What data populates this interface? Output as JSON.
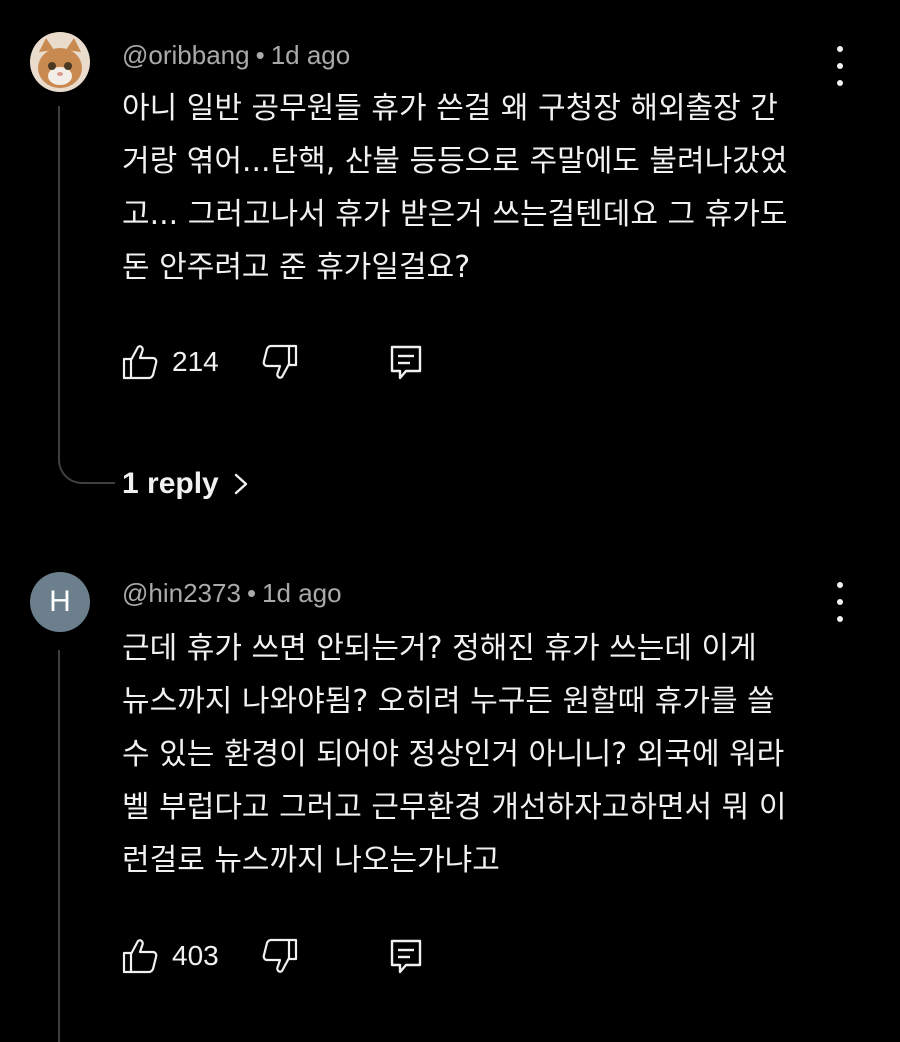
{
  "comments": [
    {
      "author": "@oribbang",
      "time": "1d ago",
      "avatar": "cat-photo",
      "lines": [
        "아니 일반 공무원들 휴가 쓴걸 왜 구청장 해외출장 간",
        "거랑 엮어...탄핵, 산불 등등으로 주말에도 불려나갔었",
        "고... 그러고나서 휴가 받은거 쓰는걸텐데요 그 휴가도",
        "돈 안주려고 준 휴가일걸요?"
      ],
      "likes": "214",
      "reply_label": "1 reply"
    },
    {
      "author": "@hin2373",
      "time": "1d ago",
      "avatar_letter": "H",
      "avatar_color": "#6b7f8d",
      "lines": [
        "근데 휴가 쓰면 안되는거? 정해진 휴가 쓰는데 이게",
        "뉴스까지 나와야됨? 오히려 누구든 원할때 휴가를 쓸",
        "수 있는 환경이 되어야 정상인거 아니니? 외국에 워라",
        "벨 부럽다고 그러고 근무환경 개선하자고하면서 뭐 이",
        "런걸로 뉴스까지 나오는가냐고"
      ],
      "likes": "403"
    }
  ]
}
